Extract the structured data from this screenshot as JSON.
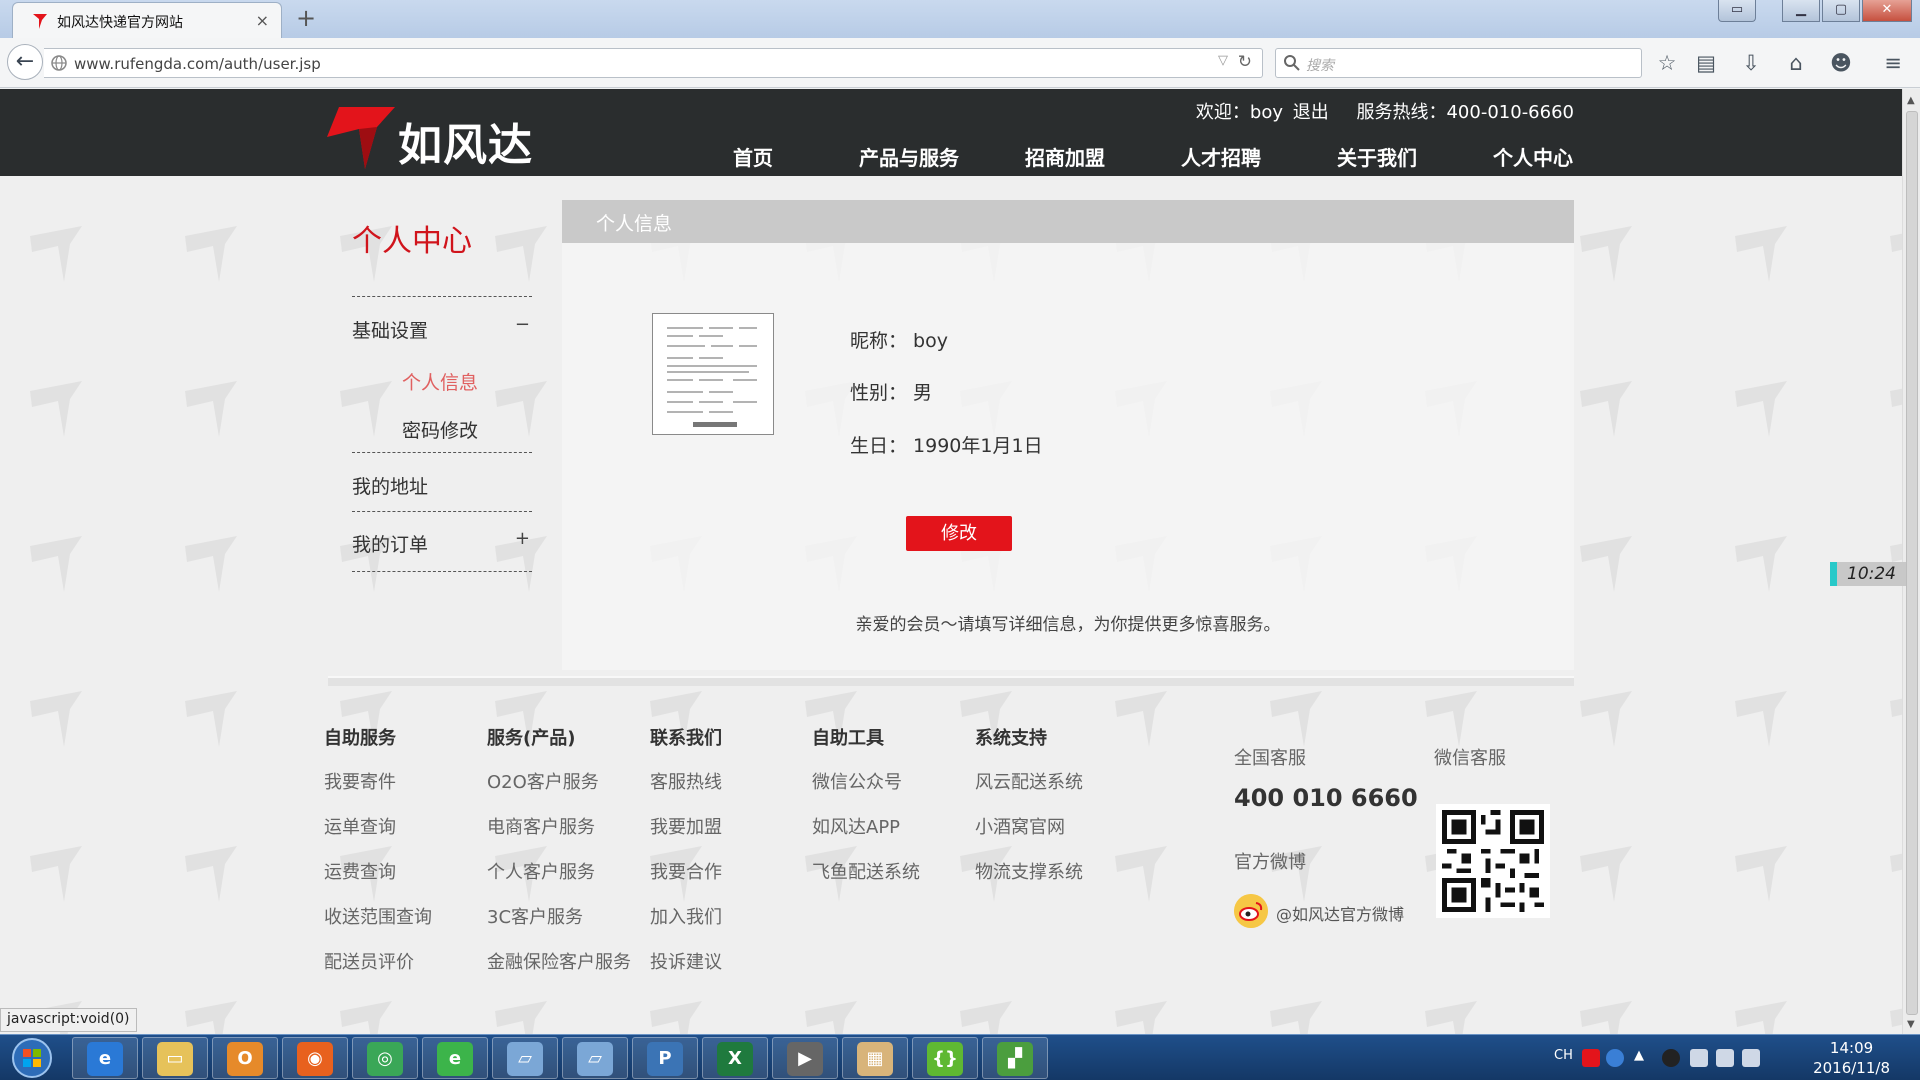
{
  "browser": {
    "tab_title": "如风达快递官方网站",
    "tab_close": "×",
    "new_tab": "+",
    "url": "www.rufengda.com/auth/user.jsp",
    "search_placeholder": "搜索"
  },
  "site": {
    "brand": "如风达",
    "welcome": "欢迎：boy",
    "logout": "退出",
    "hotline": "服务热线：400-010-6660",
    "nav": [
      "首页",
      "产品与服务",
      "招商加盟",
      "人才招聘",
      "关于我们",
      "个人中心"
    ]
  },
  "sidebar": {
    "title": "个人中心",
    "basic_settings": "基础设置",
    "basic_toggle": "−",
    "sub_items": [
      "个人信息",
      "密码修改"
    ],
    "my_address": "我的地址",
    "my_orders": "我的订单",
    "orders_toggle": "+"
  },
  "profile": {
    "panel_title": "个人信息",
    "nickname": "昵称：  boy",
    "gender": "性别：  男",
    "birthday": "生日：  1990年1月1日",
    "edit_button": "修改",
    "hint": "亲爱的会员～请填写详细信息，为你提供更多惊喜服务。"
  },
  "footer": {
    "columns": [
      {
        "title": "自助服务",
        "links": [
          "我要寄件",
          "运单查询",
          "运费查询",
          "收送范围查询",
          "配送员评价"
        ]
      },
      {
        "title": "服务(产品)",
        "links": [
          "O2O客户服务",
          "电商客户服务",
          "个人客户服务",
          "3C客户服务",
          "金融保险客户服务"
        ]
      },
      {
        "title": "联系我们",
        "links": [
          "客服热线",
          "我要加盟",
          "我要合作",
          "加入我们",
          "投诉建议"
        ]
      },
      {
        "title": "自助工具",
        "links": [
          "微信公众号",
          "如风达APP",
          "飞鱼配送系统"
        ]
      },
      {
        "title": "系统支持",
        "links": [
          "风云配送系统",
          "小酒窝官网",
          "物流支撑系统"
        ]
      }
    ],
    "national_service": "全国客服",
    "wechat_service": "微信客服",
    "phone": "400 010 6660",
    "official_weibo": "官方微博",
    "weibo_handle": "@如风达官方微博"
  },
  "status_bar": "javascript:void(0)",
  "clock_widget": "10:24",
  "taskbar": {
    "lang": "CH",
    "time": "14:09",
    "date": "2016/11/8"
  },
  "colors": {
    "brand_red": "#e3141b",
    "header_dark": "#2a2d2e",
    "taskbar_blue": "#1f4f8a"
  }
}
